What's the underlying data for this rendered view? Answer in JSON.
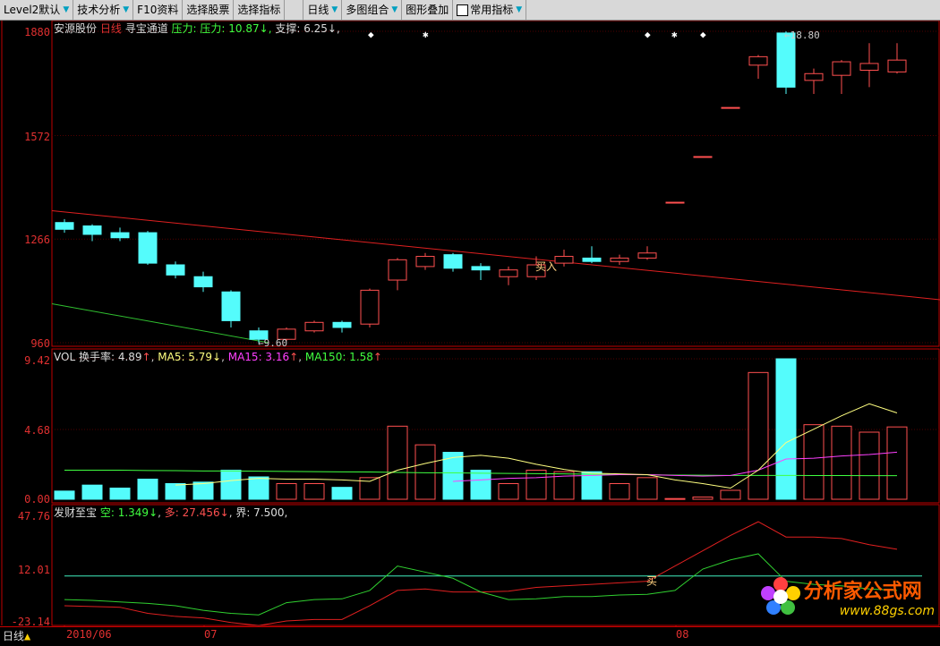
{
  "toolbar": {
    "items": [
      {
        "label": "Level2默认",
        "arrow": true
      },
      {
        "label": "技术分析",
        "arrow": true
      },
      {
        "label": "F10资料",
        "arrow": false
      },
      {
        "label": "选择股票",
        "arrow": false
      },
      {
        "label": "选择指标",
        "arrow": false
      },
      {
        "label": "日线",
        "arrow": true
      },
      {
        "label": "多图组合",
        "arrow": true
      },
      {
        "label": "图形叠加",
        "arrow": false
      },
      {
        "label": "常用指标",
        "arrow": true
      }
    ]
  },
  "main_panel": {
    "stock_name": "安源股份",
    "period": "日线",
    "indicator": "寻宝通道",
    "pressure_label": "压力: 10.87",
    "pressure_arrow": "↓",
    "support_label": "支撑: 6.25",
    "support_arrow": "↓",
    "y_ticks": [
      "1880",
      "1572",
      "1266",
      "960"
    ],
    "high_label": "18.80",
    "low_label": "9.60",
    "buy_label": "买入"
  },
  "vol_panel": {
    "name": "VOL",
    "turnover": "换手率: 4.89",
    "ma5": "MA5: 5.79",
    "ma15": "MA15: 3.16",
    "ma150": "MA150: 1.58",
    "y_ticks": [
      "9.42",
      "4.68",
      "0.00"
    ]
  },
  "ind_panel": {
    "name": "发财至宝",
    "empty": "空: 1.349",
    "long": "多: 27.456",
    "bound": "界: 7.500,",
    "y_ticks": [
      "47.76",
      "12.01",
      "-23.14"
    ],
    "buy_label": "买"
  },
  "bottom": {
    "period": "日线",
    "dates": [
      "2010/06",
      "07",
      "08"
    ]
  },
  "logo": {
    "cn": "分析家公式网",
    "url": "www.88gs.com"
  },
  "colors": {
    "up": "#ff5050",
    "down": "#54fcfc",
    "ma5": "#ffff80",
    "ma15": "#ff40ff",
    "ma150": "#40ff40",
    "axis": "#c00000"
  },
  "chart_data": {
    "type": "candlestick",
    "candles": [
      {
        "o": 13.15,
        "c": 12.95,
        "h": 13.25,
        "l": 12.85
      },
      {
        "o": 13.05,
        "c": 12.8,
        "h": 13.1,
        "l": 12.6
      },
      {
        "o": 12.85,
        "c": 12.7,
        "h": 13.0,
        "l": 12.6
      },
      {
        "o": 12.85,
        "c": 11.95,
        "h": 12.9,
        "l": 11.9
      },
      {
        "o": 11.9,
        "c": 11.6,
        "h": 12.0,
        "l": 11.5
      },
      {
        "o": 11.55,
        "c": 11.25,
        "h": 11.7,
        "l": 11.1
      },
      {
        "o": 11.1,
        "c": 10.25,
        "h": 11.15,
        "l": 10.05
      },
      {
        "o": 9.95,
        "c": 9.7,
        "h": 10.05,
        "l": 9.6
      },
      {
        "o": 9.7,
        "c": 10.0,
        "h": 10.05,
        "l": 9.65
      },
      {
        "o": 9.95,
        "c": 10.2,
        "h": 10.25,
        "l": 9.9
      },
      {
        "o": 10.2,
        "c": 10.05,
        "h": 10.25,
        "l": 9.9
      },
      {
        "o": 10.15,
        "c": 11.15,
        "h": 11.2,
        "l": 10.05
      },
      {
        "o": 11.45,
        "c": 12.05,
        "h": 12.1,
        "l": 11.15
      },
      {
        "o": 11.85,
        "c": 12.15,
        "h": 12.25,
        "l": 11.75
      },
      {
        "o": 12.2,
        "c": 11.8,
        "h": 12.25,
        "l": 11.7
      },
      {
        "o": 11.85,
        "c": 11.75,
        "h": 11.95,
        "l": 11.45
      },
      {
        "o": 11.55,
        "c": 11.75,
        "h": 11.85,
        "l": 11.3
      },
      {
        "o": 11.55,
        "c": 11.9,
        "h": 12.15,
        "l": 11.45
      },
      {
        "o": 11.95,
        "c": 12.15,
        "h": 12.35,
        "l": 11.85
      },
      {
        "o": 12.1,
        "c": 12.0,
        "h": 12.45,
        "l": 11.95
      },
      {
        "o": 12.0,
        "c": 12.1,
        "h": 12.2,
        "l": 11.9
      },
      {
        "o": 12.1,
        "c": 12.25,
        "h": 12.45,
        "l": 12.05
      },
      {
        "o": 13.75,
        "c": 13.75,
        "h": 13.75,
        "l": 13.75
      },
      {
        "o": 15.1,
        "c": 15.1,
        "h": 15.1,
        "l": 15.1
      },
      {
        "o": 16.55,
        "c": 16.55,
        "h": 16.55,
        "l": 16.55
      },
      {
        "o": 17.8,
        "c": 18.05,
        "h": 18.1,
        "l": 17.4
      },
      {
        "o": 18.75,
        "c": 17.15,
        "h": 18.8,
        "l": 16.95
      },
      {
        "o": 17.35,
        "c": 17.55,
        "h": 17.7,
        "l": 16.95
      },
      {
        "o": 17.5,
        "c": 17.9,
        "h": 17.95,
        "l": 16.95
      },
      {
        "o": 17.65,
        "c": 17.85,
        "h": 18.45,
        "l": 17.15
      },
      {
        "o": 17.6,
        "c": 17.95,
        "h": 18.45,
        "l": 17.55
      }
    ],
    "volume": [
      0.55,
      0.95,
      0.75,
      1.35,
      1.05,
      1.15,
      1.95,
      1.5,
      1.05,
      1.05,
      0.8,
      1.45,
      4.9,
      3.65,
      3.15,
      1.95,
      1.05,
      1.95,
      1.85,
      1.85,
      1.05,
      1.45,
      0.05,
      0.15,
      0.6,
      8.5,
      9.42,
      5.0,
      4.9,
      4.5,
      4.85
    ],
    "ma5": [
      null,
      null,
      null,
      null,
      0.95,
      1.05,
      1.25,
      1.4,
      1.35,
      1.35,
      1.3,
      1.2,
      1.95,
      2.4,
      2.8,
      2.95,
      2.75,
      2.35,
      2.0,
      1.75,
      1.7,
      1.65,
      1.3,
      1.05,
      0.75,
      1.95,
      3.8,
      4.7,
      5.6,
      6.4,
      5.79
    ],
    "ma15": [
      null,
      null,
      null,
      null,
      null,
      null,
      null,
      null,
      null,
      null,
      null,
      null,
      null,
      null,
      1.2,
      1.3,
      1.4,
      1.45,
      1.55,
      1.6,
      1.65,
      1.65,
      1.6,
      1.55,
      1.6,
      1.95,
      2.7,
      2.75,
      2.9,
      3.0,
      3.16
    ],
    "ma150": [
      1.95,
      1.95,
      1.95,
      1.93,
      1.92,
      1.9,
      1.9,
      1.88,
      1.87,
      1.85,
      1.84,
      1.83,
      1.8,
      1.78,
      1.77,
      1.75,
      1.73,
      1.72,
      1.7,
      1.68,
      1.66,
      1.64,
      1.62,
      1.61,
      1.6,
      1.6,
      1.6,
      1.59,
      1.59,
      1.58,
      1.58
    ],
    "ind_long": [
      -12.0,
      -12.5,
      -13.0,
      -17.0,
      -19.0,
      -20.0,
      -23.0,
      -25.0,
      -22.0,
      -21.0,
      -21.0,
      -12.0,
      -2.0,
      -1.0,
      -3.0,
      -3.0,
      -2.5,
      0,
      1.0,
      2.0,
      3.0,
      4.0,
      14.0,
      24.0,
      34.0,
      43.0,
      33.0,
      33.0,
      32.0,
      28.0,
      25.0
    ],
    "ind_empty": [
      -8.0,
      -8.5,
      -9.5,
      -10.5,
      -12.0,
      -15.0,
      -17.0,
      -18.0,
      -10.0,
      -8.0,
      -7.5,
      -2.0,
      14.0,
      10.0,
      6.0,
      -3.0,
      -8.0,
      -7.5,
      -6.0,
      -6.0,
      -5.0,
      -4.5,
      -2.0,
      12.0,
      18.0,
      22.0,
      4.0,
      2.0,
      1.0,
      -1.0,
      -2.0
    ],
    "ind_bound": 7.5
  }
}
